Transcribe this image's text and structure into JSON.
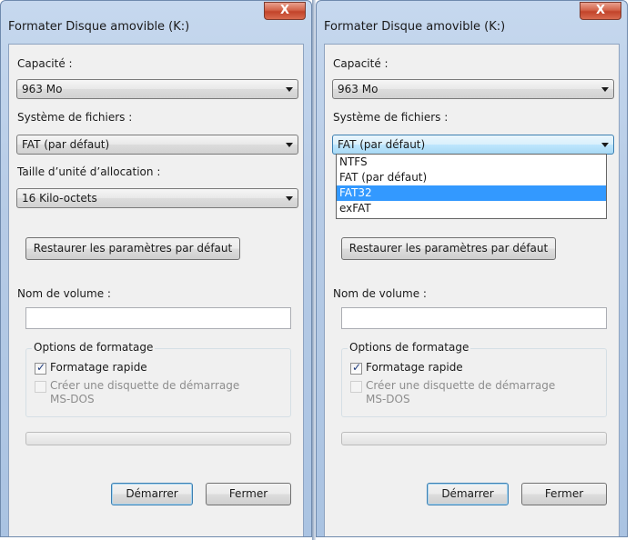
{
  "left": {
    "title": "Formater Disque amovible (K:)",
    "close_label": "X",
    "capacity_label": "Capacité :",
    "capacity_value": "963 Mo",
    "fs_label": "Système de fichiers :",
    "fs_value": "FAT (par défaut)",
    "alloc_label": "Taille d’unité d’allocation :",
    "alloc_value": "16 Kilo-octets",
    "restore_label": "Restaurer les paramètres par défaut",
    "volume_label": "Nom de volume :",
    "volume_value": "",
    "options_legend": "Options de formatage",
    "quick_format_label": "Formatage rapide",
    "quick_format_checked": true,
    "msdos_label_1": "Créer une disquette de démarrage",
    "msdos_label_2": "MS-DOS",
    "progress": 0,
    "start_label": "Démarrer",
    "close_button_label": "Fermer"
  },
  "right": {
    "title": "Formater Disque amovible (K:)",
    "close_label": "X",
    "capacity_label": "Capacité :",
    "capacity_value": "963 Mo",
    "fs_label": "Système de fichiers :",
    "fs_value": "FAT (par défaut)",
    "fs_options": [
      "NTFS",
      "FAT (par défaut)",
      "FAT32",
      "exFAT"
    ],
    "fs_highlighted": "FAT32",
    "restore_label": "Restaurer les paramètres par défaut",
    "volume_label": "Nom de volume :",
    "volume_value": "",
    "options_legend": "Options de formatage",
    "quick_format_label": "Formatage rapide",
    "quick_format_checked": true,
    "msdos_label_1": "Créer une disquette de démarrage",
    "msdos_label_2": "MS-DOS",
    "progress": 0,
    "start_label": "Démarrer",
    "close_button_label": "Fermer"
  },
  "colors": {
    "selection": "#3399ff",
    "frame": "#b6cbe6",
    "close_button": "#c2432a"
  }
}
